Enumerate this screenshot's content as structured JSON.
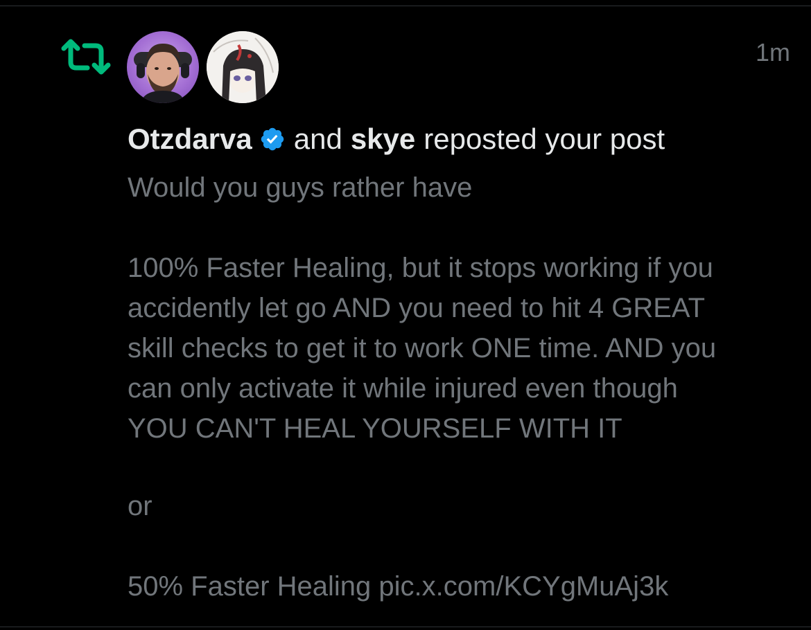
{
  "notification": {
    "timestamp": "1m",
    "user1": "Otzdarva",
    "connector": "and",
    "user2": "skye",
    "action": "reposted your post"
  },
  "post": {
    "line1": "Would you guys rather have",
    "paragraph2_lines": [
      "100% Faster Healing, but it stops working if you",
      "accidently let go AND you need to hit 4 GREAT",
      "skill checks to get it to work ONE time. AND you",
      "can only activate it while injured even though",
      "YOU CAN'T HEAL YOURSELF WITH IT"
    ],
    "or_text": "or",
    "last_line": "50% Faster Healing pic.x.com/KCYgMuAj3k"
  },
  "colors": {
    "repost_green": "#00ba7c",
    "verified_blue": "#1d9bf0",
    "secondary_text": "#71767b",
    "primary_text": "#e7e9ea"
  },
  "icons": {
    "repost": "repost-icon",
    "verified": "verified-badge-icon"
  }
}
